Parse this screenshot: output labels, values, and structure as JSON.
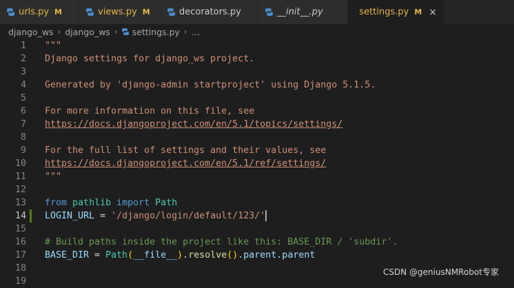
{
  "tabs": [
    {
      "label": "urls.py",
      "badge": "M"
    },
    {
      "label": "views.py",
      "badge": "M"
    },
    {
      "label": "decorators.py",
      "badge": ""
    },
    {
      "label": "__init__.py",
      "badge": ""
    },
    {
      "label": "settings.py",
      "badge": "M",
      "active": true
    }
  ],
  "breadcrumb": {
    "items": [
      "django_ws",
      "django_ws",
      "settings.py",
      "…"
    ],
    "separator": "›"
  },
  "editor": {
    "line_numbers": [
      "1",
      "2",
      "3",
      "4",
      "5",
      "6",
      "7",
      "8",
      "9",
      "10",
      "11",
      "12",
      "13",
      "14",
      "15",
      "16",
      "17",
      "18",
      "19"
    ],
    "lines": {
      "l1": "\"\"\"",
      "l2": "Django settings for django_ws project.",
      "l4": "Generated by 'django-admin startproject' using Django 5.1.5.",
      "l6": "For more information on this file, see",
      "l7": "https://docs.djangoproject.com/en/5.1/topics/settings/",
      "l9": "For the full list of settings and their values, see",
      "l10": "https://docs.djangoproject.com/en/5.1/ref/settings/",
      "l11": "\"\"\"",
      "l13": {
        "from": "from",
        "module": "pathlib",
        "import": "import",
        "name": "Path"
      },
      "l14": {
        "var": "LOGIN_URL",
        "op": " = ",
        "value": "'/django/login/default/123/'"
      },
      "l16": "# Build paths inside the project like this: BASE_DIR / 'subdir'.",
      "l17": {
        "var": "BASE_DIR",
        "op": " = ",
        "cls": "Path",
        "open": "(",
        "arg": "__file__",
        "close": ")",
        "dot1": ".",
        "fn": "resolve",
        "call": "()",
        "rest": ".parent.parent"
      }
    }
  },
  "watermark": "CSDN @geniusNMRobot专家",
  "colors": {
    "background": "#1e1e1e",
    "modified_badge": "#e3b64a",
    "string": "#ce9178",
    "keyword": "#569cd6",
    "comment": "#6a9955",
    "class": "#4ec9b0"
  }
}
